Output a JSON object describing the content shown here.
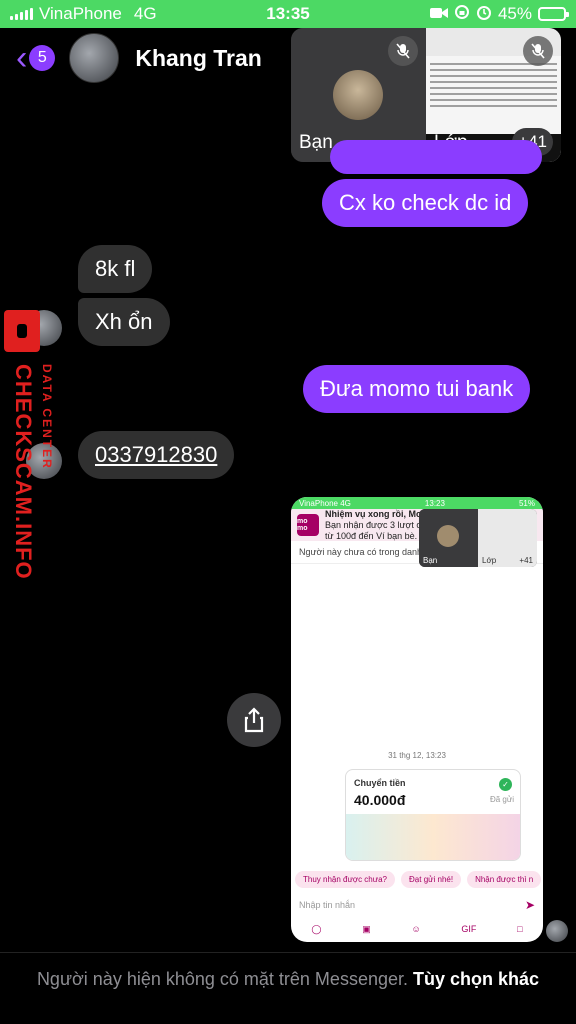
{
  "status_bar": {
    "carrier": "VinaPhone",
    "network": "4G",
    "time": "13:35",
    "battery": "45%",
    "battery_level": 0.45
  },
  "header": {
    "back_badge": "5",
    "contact_name": "Khang Tran"
  },
  "call": {
    "self_label": "Bạn",
    "class_label": "Lớp",
    "others_count": "+41"
  },
  "messages": {
    "out_1": "Cx ko check dc id",
    "in_1": "8k fl",
    "in_2": "Xh ổn",
    "out_2": "Đưa momo tui bank",
    "in_3": "0337912830"
  },
  "watermark": {
    "main": "CHECKSCAM.INFO",
    "sub": "DATA CENTER"
  },
  "attached_screenshot": {
    "carrier": "VinaPhone 4G",
    "time": "13:23",
    "battery": "51%",
    "momo_logo": "mo mo",
    "banner_title": "Nhiệm vụ xong rồi, MoMo",
    "banner_body": "Bạn nhận được 3 lượt chơi",
    "banner_body_2": "từ 100đ đến Ví bạn bè. Cù",
    "note": "Người này chưa có trong danh",
    "pip_self": "Bạn",
    "pip_class": "Lớp",
    "pip_count": "+41",
    "date": "31 thg 12, 13:23",
    "transfer_title": "Chuyển tiền",
    "transfer_amount": "40.000đ",
    "transfer_status": "Đã gửi",
    "quick_replies": [
      "Thuy nhận được chưa?",
      "Đạt gửi nhé!",
      "Nhận được thì n"
    ],
    "input_placeholder": "Nhập tin nhắn",
    "toolbar_gif": "GIF"
  },
  "footer": {
    "text": "Người này hiện không có mặt trên Messenger.",
    "link": "Tùy chọn khác"
  },
  "colors": {
    "accent": "#8b3dff",
    "status_bar": "#4cd964",
    "incoming_bubble": "#303030",
    "watermark": "#e0201f"
  }
}
